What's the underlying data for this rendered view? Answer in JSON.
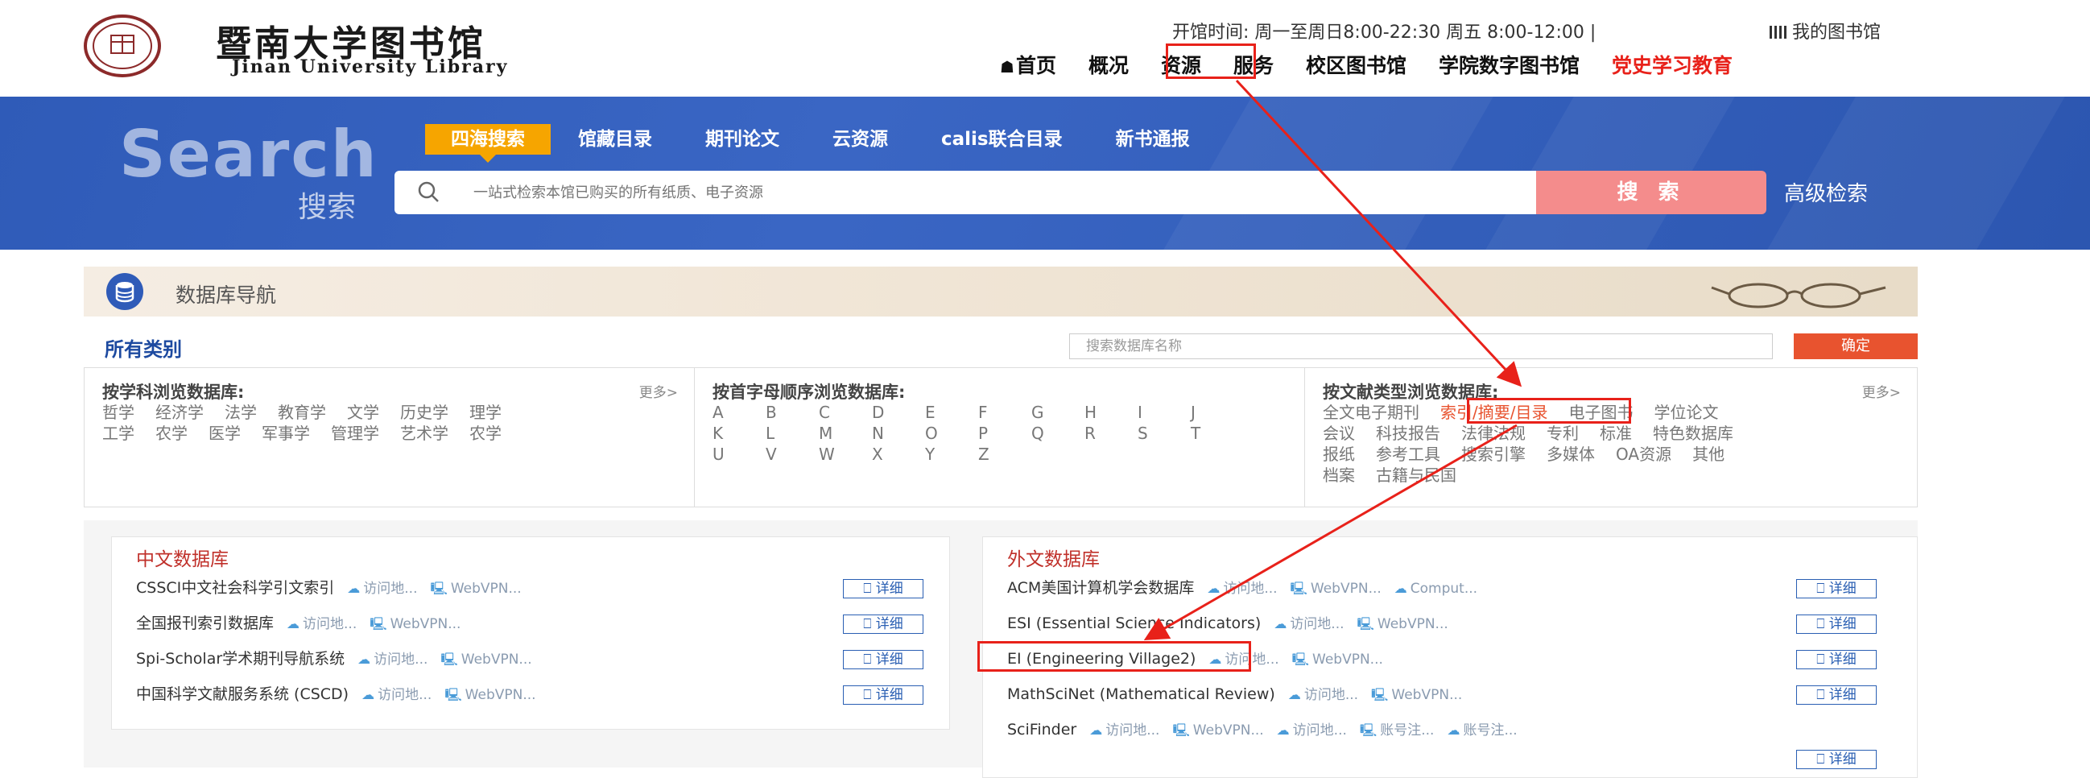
{
  "header": {
    "logo_cn": "暨南大学图书馆",
    "logo_en": "Jinan University Library",
    "hours": "开馆时间:  周一至周日8:00-22:30 周五 8:00-12:00  |",
    "my_library": "我的图书馆",
    "nav": [
      "首页",
      "概况",
      "资源",
      "服务",
      "校区图书馆",
      "学院数字图书馆",
      "党史学习教育"
    ]
  },
  "search": {
    "title_en": "Search",
    "title_cn": "搜索",
    "tabs": [
      "四海搜索",
      "馆藏目录",
      "期刊论文",
      "云资源",
      "calis联合目录",
      "新书通报"
    ],
    "placeholder": "一站式检索本馆已购买的所有纸质、电子资源",
    "button": "搜 索",
    "advanced": "高级检索"
  },
  "db_nav": {
    "label": "数据库导航",
    "all_categories": "所有类别",
    "db_search_placeholder": "搜索数据库名称",
    "ok": "确定"
  },
  "subjects": {
    "title": "按学科浏览数据库:",
    "more": "更多>",
    "row1": [
      "哲学",
      "经济学",
      "法学",
      "教育学",
      "文学",
      "历史学",
      "理学"
    ],
    "row2": [
      "工学",
      "农学",
      "医学",
      "军事学",
      "管理学",
      "艺术学",
      "农学"
    ]
  },
  "alphabet": {
    "title": "按首字母顺序浏览数据库:",
    "row1": [
      "A",
      "B",
      "C",
      "D",
      "E",
      "F",
      "G",
      "H",
      "I",
      "J"
    ],
    "row2": [
      "K",
      "L",
      "M",
      "N",
      "O",
      "P",
      "Q",
      "R",
      "S",
      "T"
    ],
    "row3": [
      "U",
      "V",
      "W",
      "X",
      "Y",
      "Z"
    ]
  },
  "doctypes": {
    "title": "按文献类型浏览数据库:",
    "more": "更多>",
    "row1": [
      "全文电子期刊",
      "索引/摘要/目录",
      "电子图书",
      "学位论文"
    ],
    "row2": [
      "会议",
      "科技报告",
      "法律法规",
      "专利",
      "标准",
      "特色数据库"
    ],
    "row3": [
      "报纸",
      "参考工具",
      "搜索引擎",
      "多媒体",
      "OA资源",
      "其他"
    ],
    "row4": [
      "档案",
      "古籍与民国"
    ]
  },
  "cn_db": {
    "title": "中文数据库",
    "items": [
      {
        "name": "CSSCI中文社会科学引文索引",
        "links": [
          "访问地...",
          "WebVPN..."
        ],
        "detail": "详细"
      },
      {
        "name": "全国报刊索引数据库",
        "links": [
          "访问地...",
          "WebVPN..."
        ],
        "detail": "详细"
      },
      {
        "name": "Spi-Scholar学术期刊导航系统",
        "links": [
          "访问地...",
          "WebVPN..."
        ],
        "detail": "详细"
      },
      {
        "name": "中国科学文献服务系统 (CSCD)",
        "links": [
          "访问地...",
          "WebVPN..."
        ],
        "detail": "详细"
      }
    ]
  },
  "fg_db": {
    "title": "外文数据库",
    "items": [
      {
        "name": "ACM美国计算机学会数据库",
        "links": [
          "访问地...",
          "WebVPN...",
          "Comput..."
        ],
        "detail": "详细"
      },
      {
        "name": "ESI (Essential Science Indicators)",
        "links": [
          "访问地...",
          "WebVPN..."
        ],
        "detail": "详细"
      },
      {
        "name": "EI (Engineering Village2)",
        "links": [
          "访问地...",
          "WebVPN..."
        ],
        "detail": "详细"
      },
      {
        "name": "MathSciNet (Mathematical Review)",
        "links": [
          "访问地...",
          "WebVPN..."
        ],
        "detail": "详细"
      },
      {
        "name": "SciFinder",
        "links": [
          "访问地...",
          "WebVPN...",
          "访问地...",
          "账号注...",
          "账号注..."
        ],
        "detail": "详细"
      }
    ]
  },
  "colors": {
    "banner": "#2f5bb8",
    "tab_active": "#f6a500",
    "search_btn": "#f48c8c",
    "annotation": "#e8211a"
  }
}
